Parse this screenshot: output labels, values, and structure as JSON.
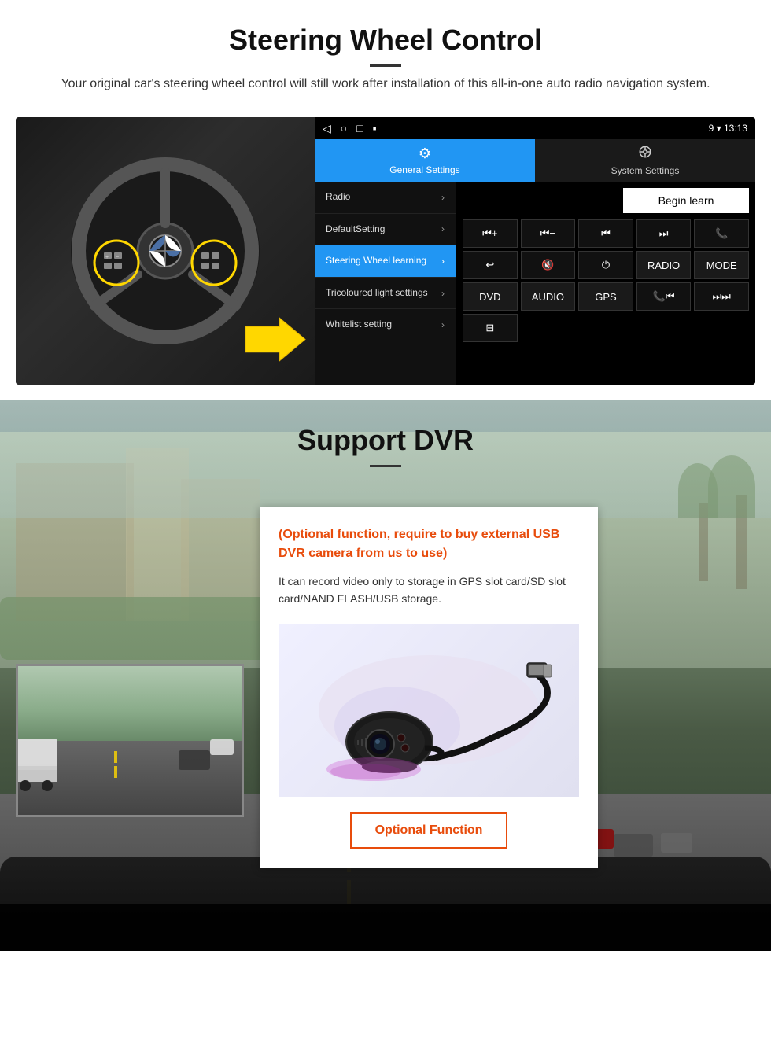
{
  "steering_section": {
    "title": "Steering Wheel Control",
    "description": "Your original car's steering wheel control will still work after installation of this all-in-one auto radio navigation system.",
    "status_bar": {
      "time": "13:13",
      "icons_left": [
        "◁",
        "○",
        "□",
        "▪"
      ],
      "icons_right": "9 ▾ 13:13"
    },
    "tabs": [
      {
        "id": "general",
        "label": "General Settings",
        "icon": "⚙",
        "active": true
      },
      {
        "id": "system",
        "label": "System Settings",
        "icon": "🔗",
        "active": false
      }
    ],
    "menu_items": [
      {
        "label": "Radio",
        "active": false
      },
      {
        "label": "DefaultSetting",
        "active": false
      },
      {
        "label": "Steering Wheel learning",
        "active": true
      },
      {
        "label": "Tricoloured light settings",
        "active": false
      },
      {
        "label": "Whitelist setting",
        "active": false
      }
    ],
    "begin_learn_label": "Begin learn",
    "control_buttons": [
      "⏮+",
      "⏮−",
      "⏮⏮",
      "⏭⏭",
      "📞",
      "↩",
      "🔇×",
      "⏻",
      "RADIO",
      "MODE",
      "DVD",
      "AUDIO",
      "GPS",
      "📞⏮",
      "⏭⏭"
    ],
    "extra_btn": "⊟"
  },
  "dvr_section": {
    "title": "Support DVR",
    "optional_text": "(Optional function, require to buy external USB DVR camera from us to use)",
    "description": "It can record video only to storage in GPS slot card/SD slot card/NAND FLASH/USB storage.",
    "optional_function_label": "Optional Function"
  }
}
